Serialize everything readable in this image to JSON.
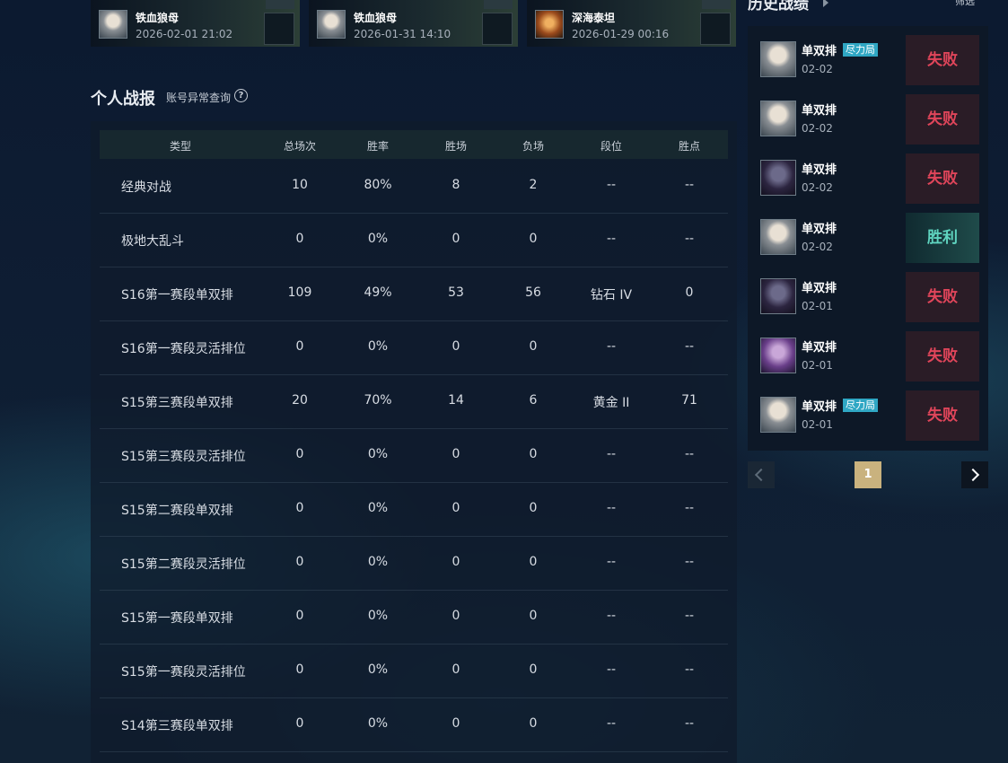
{
  "recent_games": [
    {
      "name": "铁血狼母",
      "time": "2026-02-01 21:02",
      "portrait": "grey-haired-champion"
    },
    {
      "name": "铁血狼母",
      "time": "2026-01-31 14:10",
      "portrait": "grey-haired-champion"
    },
    {
      "name": "深海泰坦",
      "time": "2026-01-29 00:16",
      "portrait": "fire-champion"
    }
  ],
  "personal": {
    "title": "个人战报",
    "abnormal_link": "账号异常查询",
    "help_icon": "?",
    "headers": [
      "类型",
      "总场次",
      "胜率",
      "胜场",
      "负场",
      "段位",
      "胜点"
    ],
    "rows": [
      {
        "type": "经典对战",
        "total": "10",
        "winrate": "80%",
        "wins": "8",
        "losses": "2",
        "rank": "--",
        "lp": "--"
      },
      {
        "type": "极地大乱斗",
        "total": "0",
        "winrate": "0%",
        "wins": "0",
        "losses": "0",
        "rank": "--",
        "lp": "--"
      },
      {
        "type": "S16第一赛段单双排",
        "total": "109",
        "winrate": "49%",
        "wins": "53",
        "losses": "56",
        "rank": "钻石 IV",
        "lp": "0"
      },
      {
        "type": "S16第一赛段灵活排位",
        "total": "0",
        "winrate": "0%",
        "wins": "0",
        "losses": "0",
        "rank": "--",
        "lp": "--"
      },
      {
        "type": "S15第三赛段单双排",
        "total": "20",
        "winrate": "70%",
        "wins": "14",
        "losses": "6",
        "rank": "黄金 II",
        "lp": "71"
      },
      {
        "type": "S15第三赛段灵活排位",
        "total": "0",
        "winrate": "0%",
        "wins": "0",
        "losses": "0",
        "rank": "--",
        "lp": "--"
      },
      {
        "type": "S15第二赛段单双排",
        "total": "0",
        "winrate": "0%",
        "wins": "0",
        "losses": "0",
        "rank": "--",
        "lp": "--"
      },
      {
        "type": "S15第二赛段灵活排位",
        "total": "0",
        "winrate": "0%",
        "wins": "0",
        "losses": "0",
        "rank": "--",
        "lp": "--"
      },
      {
        "type": "S15第一赛段单双排",
        "total": "0",
        "winrate": "0%",
        "wins": "0",
        "losses": "0",
        "rank": "--",
        "lp": "--"
      },
      {
        "type": "S15第一赛段灵活排位",
        "total": "0",
        "winrate": "0%",
        "wins": "0",
        "losses": "0",
        "rank": "--",
        "lp": "--"
      },
      {
        "type": "S14第三赛段单双排",
        "total": "0",
        "winrate": "0%",
        "wins": "0",
        "losses": "0",
        "rank": "--",
        "lp": "--"
      }
    ]
  },
  "history": {
    "title": "历史战绩",
    "filter": "筛选",
    "matches": [
      {
        "mode": "单双排",
        "tag": "尽力局",
        "date": "02-02",
        "result": "失败",
        "outcome": "lose",
        "portrait": "grey"
      },
      {
        "mode": "单双排",
        "tag": "",
        "date": "02-02",
        "result": "失败",
        "outcome": "lose",
        "portrait": "grey"
      },
      {
        "mode": "单双排",
        "tag": "",
        "date": "02-02",
        "result": "失败",
        "outcome": "lose",
        "portrait": "dark"
      },
      {
        "mode": "单双排",
        "tag": "",
        "date": "02-02",
        "result": "胜利",
        "outcome": "win",
        "portrait": "grey"
      },
      {
        "mode": "单双排",
        "tag": "",
        "date": "02-01",
        "result": "失败",
        "outcome": "lose",
        "portrait": "dark"
      },
      {
        "mode": "单双排",
        "tag": "",
        "date": "02-01",
        "result": "失败",
        "outcome": "lose",
        "portrait": "purple"
      },
      {
        "mode": "单双排",
        "tag": "尽力局",
        "date": "02-01",
        "result": "失败",
        "outcome": "lose",
        "portrait": "grey"
      }
    ],
    "page": "1"
  }
}
